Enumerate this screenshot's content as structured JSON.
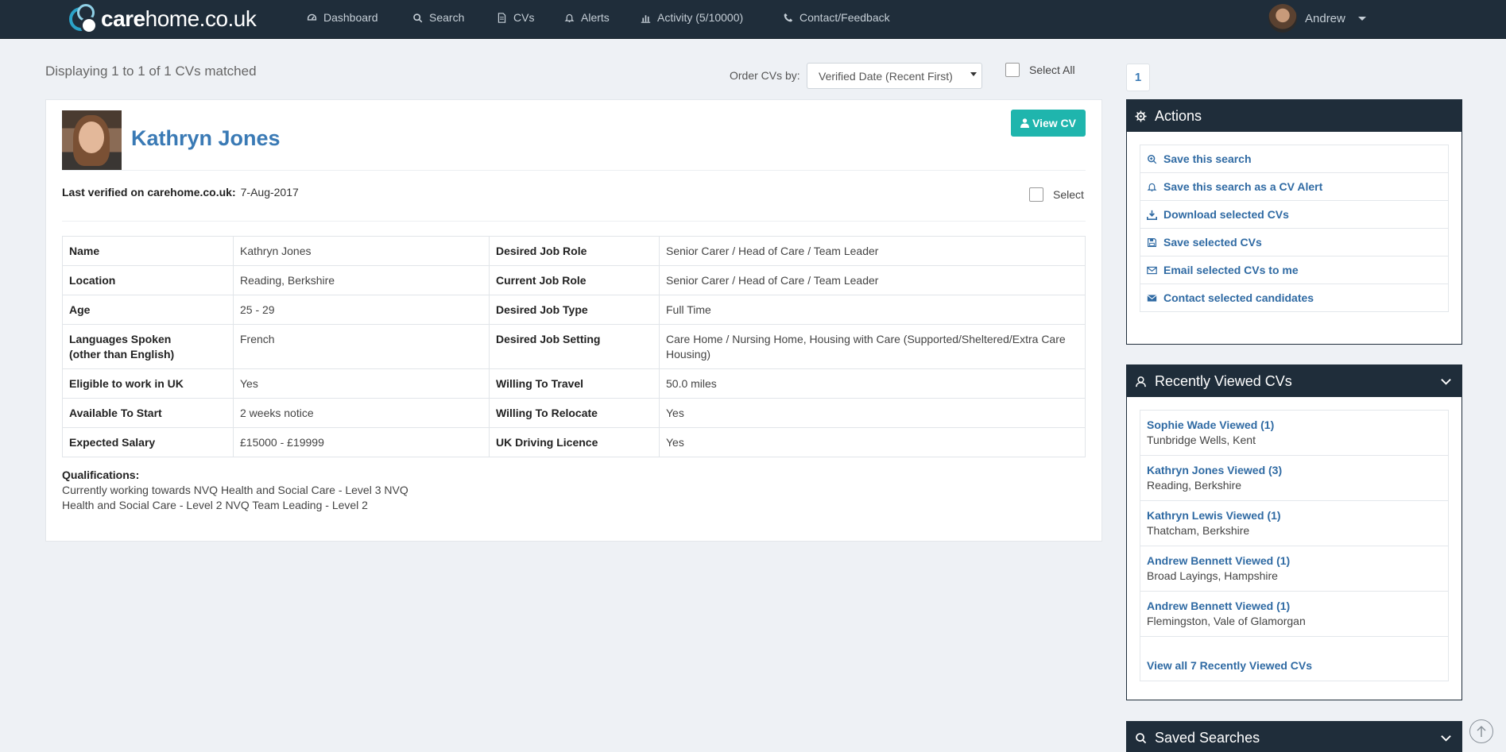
{
  "nav": {
    "logo_bold": "care",
    "logo_rest": "home.co.uk",
    "items": [
      {
        "label": "Dashboard",
        "icon": "dashboard-icon"
      },
      {
        "label": "Search",
        "icon": "search-icon"
      },
      {
        "label": "CVs",
        "icon": "document-icon"
      },
      {
        "label": "Alerts",
        "icon": "bell-icon"
      },
      {
        "label": "Activity  (5/10000)",
        "icon": "bar-chart-icon"
      },
      {
        "label": "Contact/Feedback",
        "icon": "phone-icon"
      }
    ],
    "user_name": "Andrew"
  },
  "results": {
    "summary": "Displaying 1 to 1 of 1 CVs matched",
    "order_label": "Order CVs by:",
    "order_value": "Verified Date (Recent First)",
    "select_all_label": "Select All"
  },
  "cv": {
    "name": "Kathryn Jones",
    "view_cv_label": "View CV",
    "last_verified_label": "Last verified on carehome.co.uk:",
    "last_verified_value": "7-Aug-2017",
    "select_label": "Select",
    "details": [
      {
        "l1": "Name",
        "v1": "Kathryn Jones",
        "l2": "Desired Job Role",
        "v2": "Senior Carer / Head of Care / Team Leader"
      },
      {
        "l1": "Location",
        "v1": "Reading, Berkshire",
        "l2": "Current Job Role",
        "v2": "Senior Carer / Head of Care / Team Leader"
      },
      {
        "l1": "Age",
        "v1": "25 - 29",
        "l2": "Desired Job Type",
        "v2": "Full Time"
      },
      {
        "l1": "Languages Spoken (other than English)",
        "v1": "French",
        "l2": "Desired Job Setting",
        "v2": "Care Home / Nursing Home, Housing with Care (Supported/Sheltered/Extra Care Housing)"
      },
      {
        "l1": "Eligible to work in UK",
        "v1": "Yes",
        "l2": "Willing To Travel",
        "v2": "50.0 miles"
      },
      {
        "l1": "Available To Start",
        "v1": "2 weeks notice",
        "l2": "Willing To Relocate",
        "v2": "Yes"
      },
      {
        "l1": "Expected Salary",
        "v1": "£15000 - £19999",
        "l2": "UK Driving Licence",
        "v2": "Yes"
      }
    ],
    "qualifications_label": "Qualifications:",
    "qualifications": [
      "Currently working towards NVQ Health and Social Care - Level 3 NVQ",
      "Health and Social Care - Level 2 NVQ Team Leading - Level 2"
    ]
  },
  "pager": {
    "current": "1"
  },
  "actions": {
    "title": "Actions",
    "items": [
      {
        "label": "Save this search",
        "icon": "search-plus-icon"
      },
      {
        "label": "Save this search as a CV Alert",
        "icon": "bell-icon"
      },
      {
        "label": "Download selected CVs",
        "icon": "download-icon"
      },
      {
        "label": "Save selected CVs",
        "icon": "save-icon"
      },
      {
        "label": "Email selected CVs to me",
        "icon": "envelope-outline-icon"
      },
      {
        "label": "Contact selected candidates",
        "icon": "envelope-icon"
      }
    ]
  },
  "recently_viewed": {
    "title": "Recently Viewed CVs",
    "items": [
      {
        "name": "Sophie Wade Viewed (1)",
        "location": "Tunbridge Wells, Kent"
      },
      {
        "name": "Kathryn Jones Viewed (3)",
        "location": "Reading, Berkshire"
      },
      {
        "name": "Kathryn Lewis Viewed (1)",
        "location": "Thatcham, Berkshire"
      },
      {
        "name": "Andrew Bennett Viewed (1)",
        "location": "Broad Layings, Hampshire"
      },
      {
        "name": "Andrew Bennett Viewed (1)",
        "location": "Flemingston, Vale of Glamorgan"
      }
    ],
    "view_all_label": "View all 7 Recently Viewed CVs"
  },
  "saved_searches": {
    "title": "Saved Searches"
  }
}
